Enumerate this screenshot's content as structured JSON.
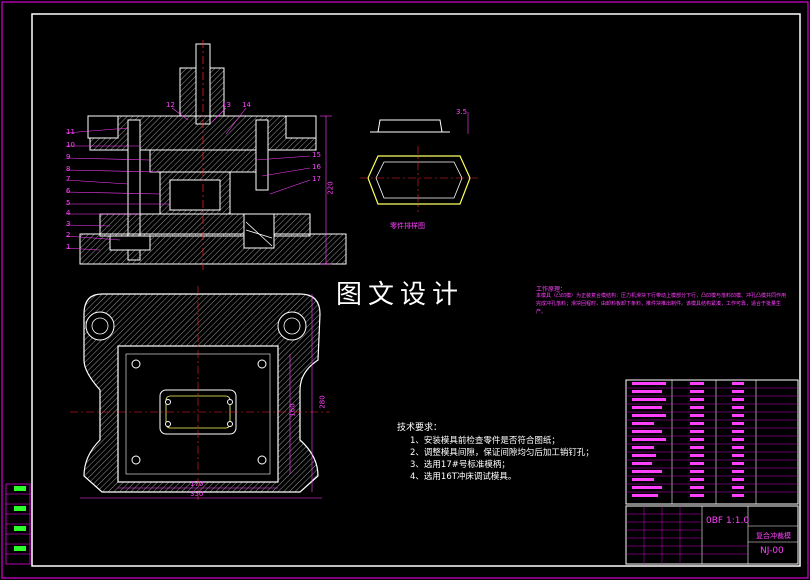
{
  "sheet": {
    "center_title": "图文设计",
    "figure_caption": "零件排样图",
    "description_heading": "工作原理：",
    "description_body": "本模具（凸凹模）为正装复合模结构：压力机滑块下行带动上模部分下行，凸凹模与落料凹模、冲孔凸模共同作用完成冲孔落料；滑块回程时，由卸料板卸下条料，推件块推出制件。该模具结构紧凑，工作可靠，适合于批量生产。",
    "technical_requirements": {
      "title": "技术要求：",
      "items": [
        "1、安装模具前检查零件是否符合图纸；",
        "2、调整模具间隙，保证间隙均匀后加工销钉孔；",
        "3、选用17#号标准模柄；",
        "4、选用16T冲床调试模具。"
      ]
    },
    "title_block": {
      "scale": "0BF",
      "ratio": "1:1.0",
      "drawing_name": "复合冲裁模",
      "drawing_number": "NJ-00"
    },
    "part_labels_left": [
      "11",
      "10",
      "9",
      "8",
      "7",
      "6",
      "5",
      "4",
      "3",
      "2",
      "1"
    ],
    "part_labels_top": [
      "12",
      "13",
      "14"
    ],
    "part_labels_right": [
      "15",
      "16",
      "17"
    ],
    "dims": {
      "plan_width": "350",
      "plan_inner": "170",
      "plan_height": "280",
      "plan_inner_h": "160",
      "section_height": "220",
      "blank_dim": "3.5"
    }
  },
  "colors": {
    "background": "#000000",
    "border": "#ff00ff",
    "line_white": "#ffffff",
    "dim_magenta": "#ff40ff",
    "center_red": "#ff2020",
    "hatch": "#c0c0c0",
    "blank_yellow": "#ffff60"
  }
}
